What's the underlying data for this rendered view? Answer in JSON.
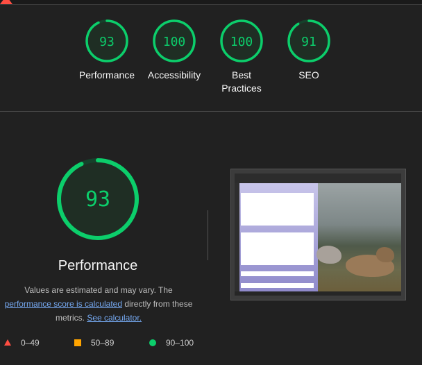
{
  "summary": {
    "gauges": [
      {
        "score": "93",
        "label_lines": [
          "Performance"
        ],
        "fraction": 0.93
      },
      {
        "score": "100",
        "label_lines": [
          "Accessibility"
        ],
        "fraction": 1.0
      },
      {
        "score": "100",
        "label_lines": [
          "Best",
          "Practices"
        ],
        "fraction": 1.0
      },
      {
        "score": "91",
        "label_lines": [
          "SEO"
        ],
        "fraction": 0.91
      }
    ]
  },
  "performance": {
    "score": "93",
    "fraction": 0.93,
    "title": "Performance",
    "desc_prefix": "Values are estimated and may vary. The",
    "link_score": "performance score is calculated",
    "desc_mid": "directly from these metrics.",
    "link_calc": "See calculator."
  },
  "legend": [
    {
      "range": "0–49",
      "icon": "fail-triangle-icon"
    },
    {
      "range": "50–89",
      "icon": "average-square-icon"
    },
    {
      "range": "90–100",
      "icon": "pass-circle-icon"
    }
  ],
  "colors": {
    "pass": "#0cce6b",
    "average": "#ffa400",
    "fail": "#ff4e42",
    "link": "#75a8f0"
  }
}
